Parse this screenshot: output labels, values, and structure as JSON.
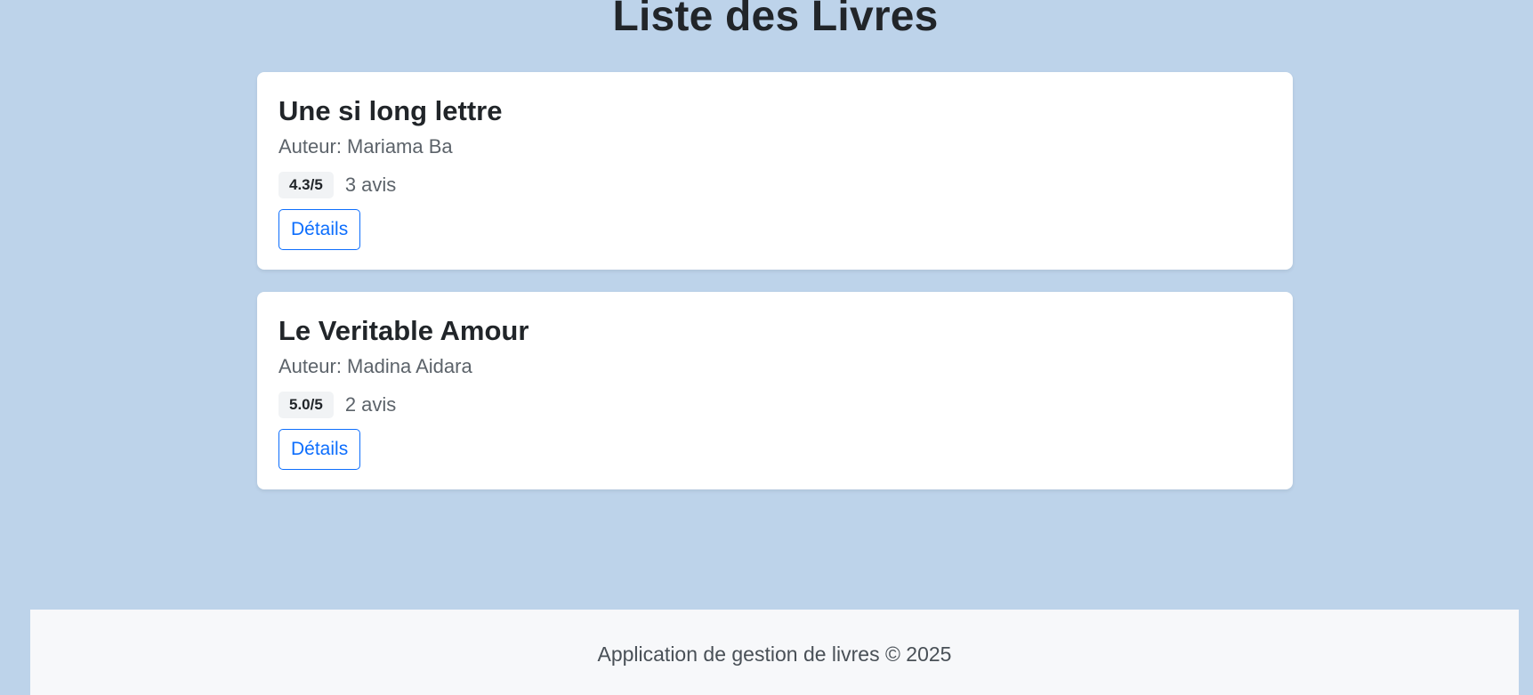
{
  "page": {
    "title": "Liste des Livres"
  },
  "books": [
    {
      "title": "Une si long lettre",
      "author": "Auteur: Mariama Ba",
      "rating": "4.3/5",
      "reviews": "3 avis",
      "details_label": "Détails"
    },
    {
      "title": "Le Veritable Amour",
      "author": "Auteur: Madina Aidara",
      "rating": "5.0/5",
      "reviews": "2 avis",
      "details_label": "Détails"
    }
  ],
  "footer": {
    "text": "Application de gestion de livres © 2025"
  },
  "colors": {
    "background": "#bdd3ea",
    "card": "#ffffff",
    "accent": "#0d6efd",
    "footer": "#f7f8fa"
  }
}
